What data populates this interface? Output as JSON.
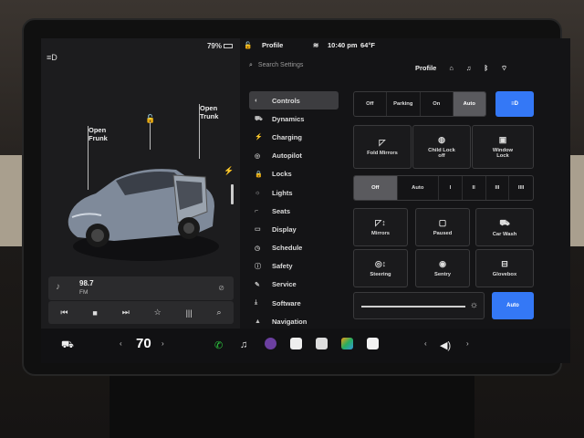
{
  "status": {
    "battery": "79%",
    "profile": "Profile",
    "time": "10:40 pm",
    "temp": "64°F"
  },
  "car": {
    "open_frunk": "Open\nFrunk",
    "open_trunk": "Open\nTrunk"
  },
  "media": {
    "station": "98.7",
    "band": "FM"
  },
  "search": {
    "placeholder": "Search Settings",
    "profile": "Profile"
  },
  "menu": [
    {
      "label": "Controls",
      "icon": "toggle-icon",
      "glyph": "◐",
      "active": true
    },
    {
      "label": "Dynamics",
      "icon": "car-icon",
      "glyph": "⛟",
      "active": false
    },
    {
      "label": "Charging",
      "icon": "bolt-icon",
      "glyph": "⚡",
      "active": false
    },
    {
      "label": "Autopilot",
      "icon": "steering-icon",
      "glyph": "◎",
      "active": false
    },
    {
      "label": "Locks",
      "icon": "lock-icon",
      "glyph": "🔒",
      "active": false
    },
    {
      "label": "Lights",
      "icon": "sun-icon",
      "glyph": "☼",
      "active": false
    },
    {
      "label": "Seats",
      "icon": "seat-icon",
      "glyph": "⌐",
      "active": false
    },
    {
      "label": "Display",
      "icon": "display-icon",
      "glyph": "▭",
      "active": false
    },
    {
      "label": "Schedule",
      "icon": "clock-icon",
      "glyph": "◷",
      "active": false
    },
    {
      "label": "Safety",
      "icon": "alert-icon",
      "glyph": "ⓘ",
      "active": false
    },
    {
      "label": "Service",
      "icon": "wrench-icon",
      "glyph": "✎",
      "active": false
    },
    {
      "label": "Software",
      "icon": "download-icon",
      "glyph": "⤓",
      "active": false
    },
    {
      "label": "Navigation",
      "icon": "nav-icon",
      "glyph": "▲",
      "active": false
    }
  ],
  "lights": {
    "options": [
      "Off",
      "Parking",
      "On",
      "Auto"
    ],
    "selected": "Auto"
  },
  "controls": {
    "fold_mirrors": "Fold Mirrors",
    "child_lock": "Child Lock\noff",
    "window_lock": "Window\nLock"
  },
  "wipers": {
    "options": [
      "Off",
      "Auto",
      "I",
      "II",
      "III",
      "IIII"
    ],
    "selected": "Off"
  },
  "tiles": {
    "mirrors": "Mirrors",
    "paused": "Paused",
    "car_wash": "Car Wash",
    "steering": "Steering",
    "sentry": "Sentry",
    "glovebox": "Glovebox"
  },
  "brightness": {
    "auto_label": "Auto"
  },
  "dock": {
    "temp": "70"
  }
}
